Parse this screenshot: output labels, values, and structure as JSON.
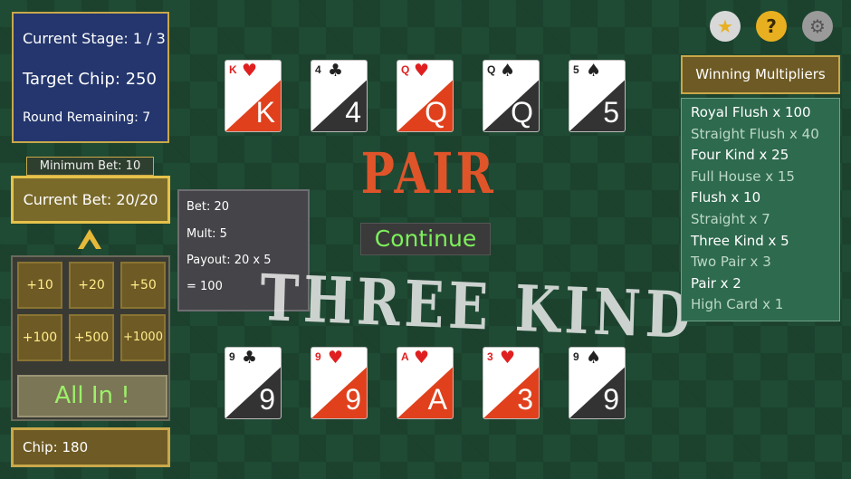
{
  "stage": {
    "current_stage": "Current Stage: 1 / 3",
    "target_chip": "Target Chip: 250",
    "round_remaining": "Round Remaining: 7"
  },
  "bet": {
    "minimum_bet": "Minimum Bet: 10",
    "current_bet": "Current Bet: 20/20"
  },
  "chip_buttons": [
    "+10",
    "+20",
    "+50",
    "+100",
    "+500",
    "+1000"
  ],
  "all_in_label": "All In !",
  "chip_total": "Chip: 180",
  "calculation": {
    "bet": "Bet: 20",
    "mult": "Mult: 5",
    "payout": "Payout: 20 x 5",
    "result": " = 100"
  },
  "dealer_hand": {
    "cards": [
      {
        "rank": "K",
        "suit": "♥",
        "color": "red"
      },
      {
        "rank": "4",
        "suit": "♣",
        "color": "black"
      },
      {
        "rank": "Q",
        "suit": "♥",
        "color": "red"
      },
      {
        "rank": "Q",
        "suit": "♠",
        "color": "black"
      },
      {
        "rank": "5",
        "suit": "♠",
        "color": "black"
      }
    ],
    "result": "PAIR"
  },
  "player_hand": {
    "cards": [
      {
        "rank": "9",
        "suit": "♣",
        "color": "black"
      },
      {
        "rank": "9",
        "suit": "♥",
        "color": "red"
      },
      {
        "rank": "A",
        "suit": "♥",
        "color": "red"
      },
      {
        "rank": "3",
        "suit": "♥",
        "color": "red"
      },
      {
        "rank": "9",
        "suit": "♠",
        "color": "black"
      }
    ],
    "result": "THREE KIND"
  },
  "continue_label": "Continue",
  "icons": [
    "star-icon",
    "help-icon",
    "gear-icon"
  ],
  "multipliers": {
    "title": "Winning Multipliers",
    "items": [
      {
        "label": "Royal Flush x 100",
        "active": true
      },
      {
        "label": "Straight Flush x 40",
        "active": false
      },
      {
        "label": "Four Kind x 25",
        "active": true
      },
      {
        "label": "Full House x 15",
        "active": false
      },
      {
        "label": "Flush x 10",
        "active": true
      },
      {
        "label": "Straight x 7",
        "active": false
      },
      {
        "label": "Three Kind x 5",
        "active": true
      },
      {
        "label": "Two Pair x 3",
        "active": false
      },
      {
        "label": "Pair x 2",
        "active": true
      },
      {
        "label": "High Card x 1",
        "active": false
      }
    ]
  },
  "colors": {
    "table_green": "#1f4a33",
    "gold_border": "#c9a84a",
    "red_card": "#e0401c",
    "black_card": "#333333",
    "accent_green": "#7cf05a",
    "pair_orange": "#e0542a"
  }
}
